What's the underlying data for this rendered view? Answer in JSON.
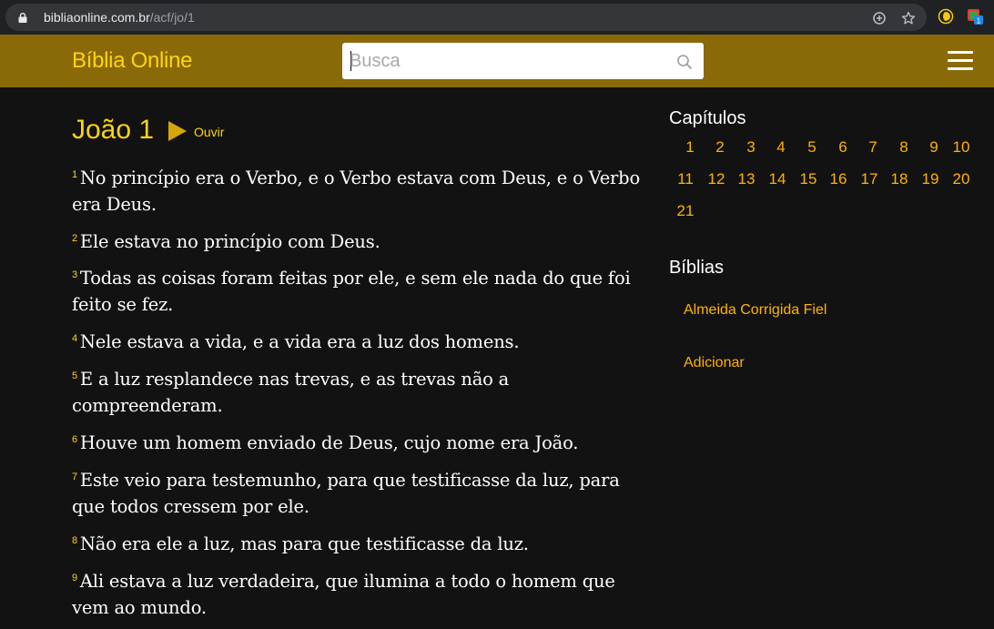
{
  "browser": {
    "url_domain": "bibliaonline.com.br",
    "url_path": "/acf/jo/1"
  },
  "header": {
    "brand": "Bíblia Online",
    "search_placeholder": "Busca"
  },
  "chapter": {
    "title": "João 1",
    "listen_label": "Ouvir",
    "verses": [
      {
        "num": "1",
        "text": "No princípio era o Verbo, e o Verbo estava com Deus, e o Verbo era Deus."
      },
      {
        "num": "2",
        "text": "Ele estava no princípio com Deus."
      },
      {
        "num": "3",
        "text": "Todas as coisas foram feitas por ele, e sem ele nada do que foi feito se fez."
      },
      {
        "num": "4",
        "text": "Nele estava a vida, e a vida era a luz dos homens."
      },
      {
        "num": "5",
        "text": "E a luz resplandece nas trevas, e as trevas não a compreenderam."
      },
      {
        "num": "6",
        "text": "Houve um homem enviado de Deus, cujo nome era João."
      },
      {
        "num": "7",
        "text": "Este veio para testemunho, para que testificasse da luz, para que todos cressem por ele."
      },
      {
        "num": "8",
        "text": "Não era ele a luz, mas para que testificasse da luz."
      },
      {
        "num": "9",
        "text": "Ali estava a luz verdadeira, que ilumina a todo o homem que vem ao mundo."
      }
    ]
  },
  "sidebar": {
    "chapters_heading": "Capítulos",
    "chapters": [
      "1",
      "2",
      "3",
      "4",
      "5",
      "6",
      "7",
      "8",
      "9",
      "10",
      "11",
      "12",
      "13",
      "14",
      "15",
      "16",
      "17",
      "18",
      "19",
      "20",
      "21"
    ],
    "bibles_heading": "Bíblias",
    "bible_link": "Almeida Corrigida Fiel",
    "add_link": "Adicionar"
  },
  "colors": {
    "header_bg": "#8a6a08",
    "accent_yellow": "#ffd40f",
    "link_orange": "#ffb300",
    "page_bg": "#121212"
  }
}
